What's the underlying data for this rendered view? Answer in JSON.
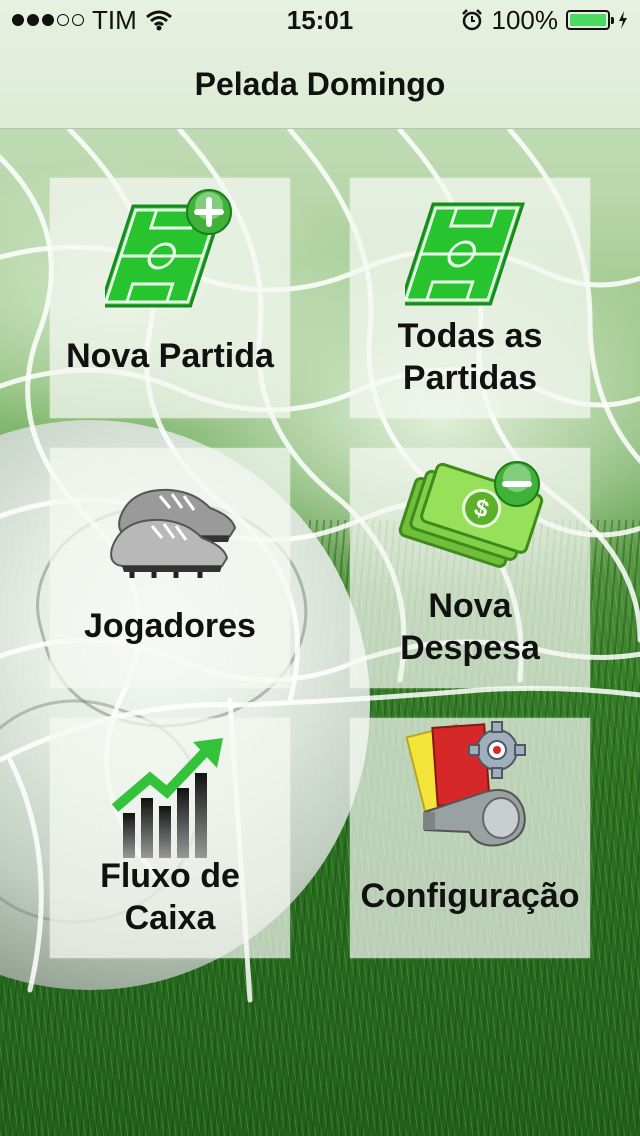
{
  "status_bar": {
    "carrier": "TIM",
    "time": "15:01",
    "battery": "100%",
    "signal_strength": 3,
    "signal_max": 5
  },
  "nav": {
    "title": "Pelada Domingo"
  },
  "menu": {
    "nova_partida": "Nova Partida",
    "todas_partidas_line1": "Todas as",
    "todas_partidas_line2": "Partidas",
    "jogadores": "Jogadores",
    "nova_despesa_line1": "Nova",
    "nova_despesa_line2": "Despesa",
    "fluxo_caixa_line1": "Fluxo de",
    "fluxo_caixa_line2": "Caixa",
    "configuracao": "Configuração"
  },
  "icons": {
    "nova_partida": "soccer-field-plus-icon",
    "todas_partidas": "soccer-field-icon",
    "jogadores": "cleats-icon",
    "nova_despesa": "money-minus-icon",
    "fluxo_caixa": "chart-growth-icon",
    "configuracao": "whistle-cards-gear-icon"
  },
  "colors": {
    "navbar": "#e6f0e0",
    "field_green": "#2fd13a",
    "battery_green": "#4cd964",
    "tile_bg": "#f5f8f3"
  }
}
